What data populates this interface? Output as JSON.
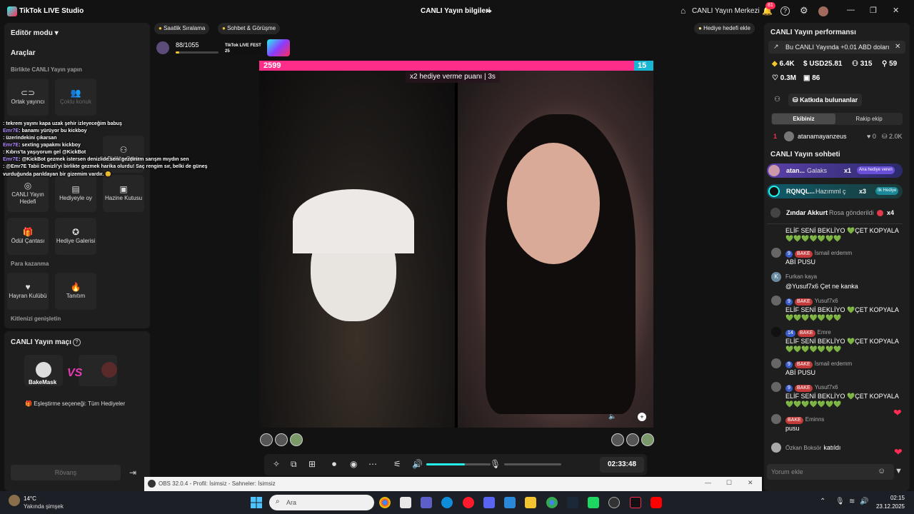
{
  "app": {
    "title": "TikTok LIVE Studio",
    "live_info": "CANLI Yayın bilgileri",
    "live_center": "CANLI Yayın Merkezi",
    "notif_count": "81"
  },
  "left": {
    "editor_mode": "Editör modu",
    "tools_title": "Araçlar",
    "section_together": "Birlikte CANLI Yayın yapın",
    "tool_cohost": "Ortak yayıncı",
    "tool_multiguest": "Çoklu konuk",
    "tool_play_together": "Birlikte Oyna",
    "tool_live_goal": "CANLI Yayın Hedefi",
    "tool_gift_vote": "Hediyeyle oy",
    "tool_treasure": "Hazine Kutusu",
    "tool_reward": "Ödül Çantası",
    "tool_gift_gallery": "Hediye Galerisi",
    "section_monetize": "Para kazanma",
    "tool_fan_club": "Hayran Kulübü",
    "tool_promo": "Tanıtım",
    "section_audience": "Kitlenizi genişletin",
    "match_title": "CANLI Yayın maçı",
    "match_user": "BakeMask",
    "vs": "VS",
    "pairing": "Eşleştirme seçeneği: Tüm Hediyeler",
    "rematch": "Rövanş"
  },
  "overlay_chat": [
    {
      "user": "",
      "text": ": tekrem yayını kapa uzak şehir izleyeceğim babuş"
    },
    {
      "user": "Emr7E",
      "text": ": banamı yürüyor bu kickboy"
    },
    {
      "user": "",
      "text": ": üzerindekini çıkarsan"
    },
    {
      "user": "Emr7E",
      "text": ": sexting yapakmı kickboy"
    },
    {
      "user": "",
      "text": ": Kıbrıs'ta yaşıyorum gel @KickBot"
    },
    {
      "user": "Emr7E",
      "text": ": @KickBot gezmek istersen denizlide seni gezdirirm sarışm mıydın sen"
    },
    {
      "user": "",
      "text": ": @Emr7E Tabii Denizli'yi birlikte gezmek harika olurdu! Saç rengim sır, belki de güneş"
    },
    {
      "user": "",
      "text": "vurduğunda parıldayan bir gizemim vardır. 😊"
    }
  ],
  "top": {
    "hourly_rank": "Saatlik Sıralama",
    "chat_meet": "Sohbet & Görüşme",
    "progress_text": "88/1055",
    "event": "TikTok LIVE FEST 25",
    "gift_goal": "Hediye hedefi ekle"
  },
  "battle": {
    "score_left": "2599",
    "score_right": "15",
    "boost_text": "x2 hediye verme puanı",
    "boost_timer": "3s"
  },
  "controls": {
    "timer": "02:33:48",
    "volume": 0.6
  },
  "obs": {
    "label": "OBS 32.0.4 - Profil: İsimsiz - Sahneler: İsimsiz"
  },
  "right": {
    "perf_title": "CANLI Yayın performansı",
    "promo": "Bu CANLI Yayında +0.01 ABD doları",
    "stats": {
      "likes": "6.4K",
      "usd": "USD25.81",
      "viewers": "315",
      "new": "59",
      "total": "0.3M",
      "gifters": "86"
    },
    "contributors": "Katkıda bulunanlar",
    "tab_team": "Ekibiniz",
    "tab_rival": "Rakip ekip",
    "rank": {
      "pos": "1",
      "name": "atanamayanzeus",
      "a": "0",
      "b": "2.0K"
    },
    "chat_title": "CANLI Yayın sohbeti",
    "gifts": [
      {
        "name": "atan...",
        "gift": "Galaks",
        "count": "x1",
        "tag": "Ana hediye veren"
      },
      {
        "name": "RQNQL...",
        "gift": "Hazımml ç",
        "count": "x3",
        "tag": "İlk Hediye"
      },
      {
        "name": "Zındar Akkurt",
        "gift": "Rosa gönderildi",
        "count": "x4",
        "tag": ""
      }
    ],
    "messages": [
      {
        "lvl": "",
        "fan": "",
        "name": "",
        "text": "ELİF SENİ BEKLİYO 💚ÇET KOPYALA 💚💚💚💚💚💚💚"
      },
      {
        "lvl": "9",
        "fan": "BAKE",
        "name": "İsmail erdemm",
        "text": "ABİ PUSU"
      },
      {
        "lvl": "",
        "fan": "",
        "name": "Furkan kaya",
        "text": "@Yusuf7x6 Çet ne kanka"
      },
      {
        "lvl": "9",
        "fan": "BAKE",
        "name": "Yusuf7x6",
        "text": "ELİF SENİ BEKLİYO 💚ÇET KOPYALA 💚💚💚💚💚💚💚"
      },
      {
        "lvl": "14",
        "fan": "BAKE",
        "name": "Emre",
        "text": "ELİF SENİ BEKLİYO 💚ÇET KOPYALA 💚💚💚💚💚💚💚"
      },
      {
        "lvl": "9",
        "fan": "BAKE",
        "name": "İsmail erdemm",
        "text": "ABİ PUSU"
      },
      {
        "lvl": "9",
        "fan": "BAKE",
        "name": "Yusuf7x6",
        "text": "ELİF SENİ BEKLİYO 💚ÇET KOPYALA 💚💚💚💚💚💚💚"
      },
      {
        "lvl": "",
        "fan": "BAKE",
        "name": "Eminns",
        "text": "pusu"
      },
      {
        "lvl": "",
        "fan": "",
        "name": "Özkan Boksör",
        "text": "katıldı"
      }
    ],
    "comment_placeholder": "Yorum ekle"
  },
  "taskbar": {
    "temp": "14°C",
    "weather": "Yakında şimşek",
    "search": "Ara",
    "time": "02:15",
    "date": "23.12.2025"
  },
  "colors": {
    "accent_pink": "#fe2c55",
    "accent_cyan": "#25f4ee",
    "score_pink": "#ff2d8a"
  }
}
